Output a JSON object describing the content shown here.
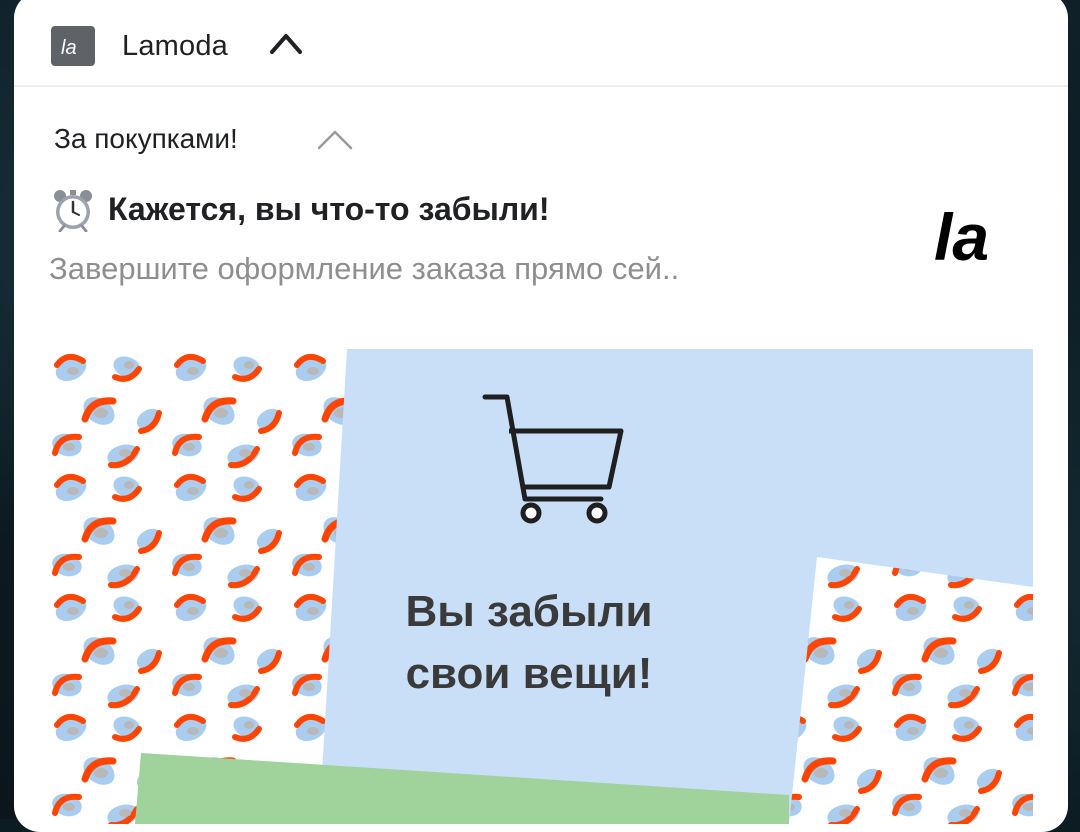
{
  "notification": {
    "app": {
      "name": "Lamoda",
      "icon": "lamoda-app-icon",
      "icon_text": "la"
    },
    "channel": "За покупками!",
    "title": "Кажется, вы что-то забыли!",
    "title_emoji": "alarm-clock-icon",
    "subtitle": "Завершите оформление заказа прямо сей..",
    "brand_logo_text": "la",
    "banner": {
      "headline_line1": "Вы забыли",
      "headline_line2": "свои вещи!",
      "icon": "shopping-cart-icon"
    }
  },
  "colors": {
    "banner_bg": "#c8dff7",
    "leopard_orange": "#ff4500",
    "leopard_blue": "#a9ccef",
    "leopard_grey": "#b8b8b8",
    "green_accent": "#9fd39b"
  }
}
